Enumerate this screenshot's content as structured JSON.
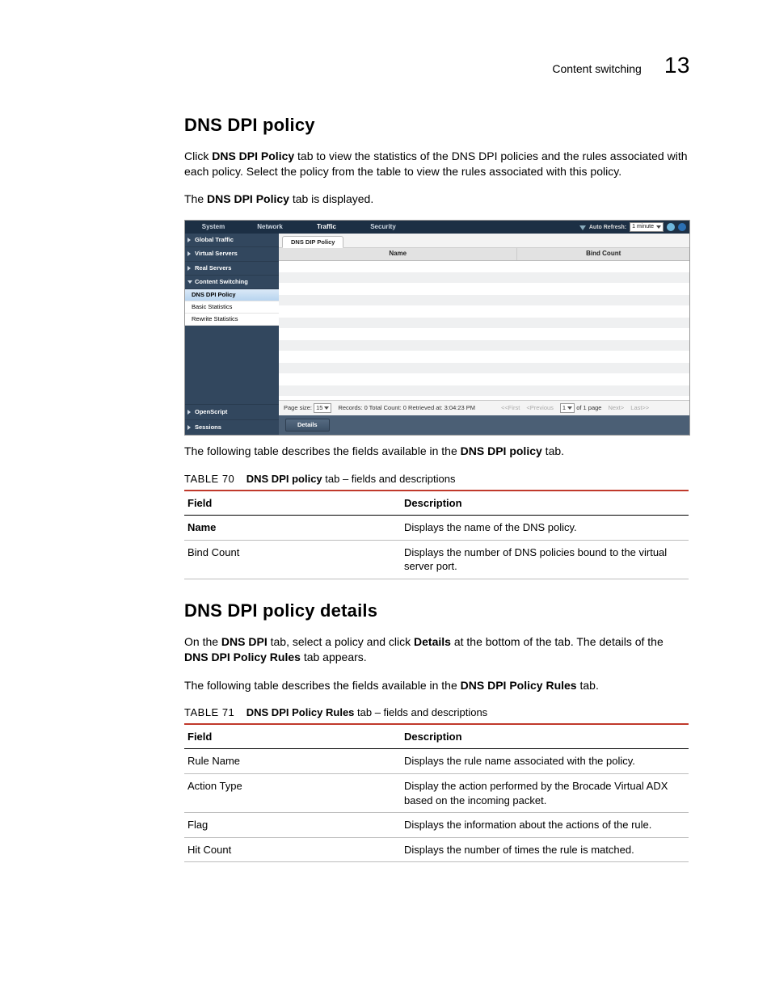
{
  "header": {
    "breadcrumb": "Content switching",
    "page_number": "13"
  },
  "section1": {
    "title": "DNS DPI policy",
    "p1a": "Click ",
    "p1b": "DNS DPI Policy",
    "p1c": " tab to view the statistics of the DNS DPI policies and the rules associated with each policy. Select the policy from the table to view the rules associated with this policy.",
    "p2a": "The ",
    "p2b": "DNS DPI Policy",
    "p2c": " tab is displayed.",
    "p3a": "The following table describes the fields available in the ",
    "p3b": "DNS DPI policy",
    "p3c": " tab."
  },
  "figure": {
    "menubar": {
      "tabs": [
        "System",
        "Network",
        "Traffic",
        "Security"
      ],
      "auto_refresh_label": "Auto Refresh:",
      "auto_refresh_value": "1 minute"
    },
    "sidebar": {
      "items": [
        {
          "label": "Global Traffic",
          "arrow": "right"
        },
        {
          "label": "Virtual Servers",
          "arrow": "right"
        },
        {
          "label": "Real Servers",
          "arrow": "right"
        },
        {
          "label": "Content Switching",
          "arrow": "down"
        }
      ],
      "subs": [
        {
          "label": "DNS DPI Policy",
          "selected": true
        },
        {
          "label": "Basic Statistics",
          "selected": false
        },
        {
          "label": "Rewrite Statistics",
          "selected": false
        }
      ],
      "bottom": [
        "OpenScript",
        "Sessions"
      ]
    },
    "content_tab": "DNS DIP Policy",
    "grid_headers": [
      "Name",
      "Bind Count"
    ],
    "pager": {
      "page_size_label": "Page size:",
      "page_size_value": "15",
      "records": "Records: 0  Total Count: 0  Retrieved at: 3:04:23 PM",
      "first": "<<First",
      "prev": "<Previous",
      "page_field": "1",
      "of_pages": "of 1 page",
      "next": "Next>",
      "last": "Last>>"
    },
    "details_button": "Details"
  },
  "table70": {
    "caption_no": "TABLE 70",
    "caption_title_bold": "DNS DPI policy",
    "caption_title_rest": " tab – fields and descriptions",
    "head": [
      "Field",
      "Description"
    ],
    "rows": [
      {
        "field_bold": true,
        "field": "Name",
        "desc": "Displays the name of the DNS policy."
      },
      {
        "field_bold": false,
        "field": "Bind Count",
        "desc": "Displays the number of DNS policies bound to the virtual server port."
      }
    ]
  },
  "section2": {
    "title": "DNS DPI policy details",
    "p1a": "On the ",
    "p1b": "DNS DPI",
    "p1c": " tab, select a policy and click ",
    "p1d": "Details",
    "p1e": " at the bottom of the tab. The details of the ",
    "p1f": "DNS DPI Policy Rules",
    "p1g": " tab appears.",
    "p2a": "The following table describes the fields available in the ",
    "p2b": "DNS DPI Policy Rules",
    "p2c": " tab."
  },
  "table71": {
    "caption_no": "TABLE 71",
    "caption_title_bold": "DNS DPI Policy Rules",
    "caption_title_rest": " tab – fields and descriptions",
    "head": [
      "Field",
      "Description"
    ],
    "rows": [
      {
        "field": "Rule Name",
        "desc": "Displays the rule name associated with the policy."
      },
      {
        "field": "Action Type",
        "desc": "Display the action performed by the Brocade Virtual ADX based on the incoming packet."
      },
      {
        "field": "Flag",
        "desc": "Displays the information about the actions of the rule."
      },
      {
        "field": "Hit Count",
        "desc": "Displays the number of times the rule is matched."
      }
    ]
  }
}
